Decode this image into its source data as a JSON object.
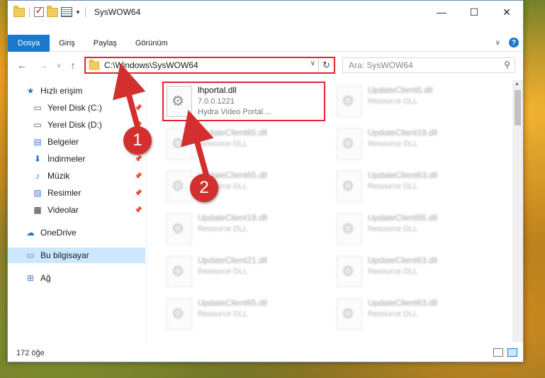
{
  "window": {
    "title": "SysWOW64",
    "controls": {
      "minimize": "—",
      "maximize": "☐",
      "close": "✕"
    }
  },
  "ribbon": {
    "tabs": [
      "Dosya",
      "Giriş",
      "Paylaş",
      "Görünüm"
    ]
  },
  "nav": {
    "address_path": "C:\\Windows\\SysWOW64",
    "search_placeholder": "Ara: SysWOW64"
  },
  "sidebar": {
    "items": [
      {
        "label": "Hızlı erişim",
        "icon": "star-icon",
        "pinned": false
      },
      {
        "label": "Yerel Disk (C:)",
        "icon": "drive-icon",
        "pinned": true
      },
      {
        "label": "Yerel Disk (D:)",
        "icon": "drive-icon",
        "pinned": true
      },
      {
        "label": "Belgeler",
        "icon": "documents-icon",
        "pinned": true
      },
      {
        "label": "İndirmeler",
        "icon": "download-icon",
        "pinned": true
      },
      {
        "label": "Müzik",
        "icon": "music-icon",
        "pinned": true
      },
      {
        "label": "Resimler",
        "icon": "pictures-icon",
        "pinned": true
      },
      {
        "label": "Videolar",
        "icon": "videos-icon",
        "pinned": true
      },
      {
        "label": "OneDrive",
        "icon": "cloud-icon",
        "pinned": false
      },
      {
        "label": "Bu bilgisayar",
        "icon": "computer-icon",
        "pinned": false
      },
      {
        "label": "Ağ",
        "icon": "network-icon",
        "pinned": false
      }
    ]
  },
  "files": {
    "highlighted": {
      "name": "lhportal.dll",
      "version": "7.0.0.1221",
      "description": "Hydra Video Portal ..."
    },
    "left_column": [
      {
        "name": "UpdateClient65.dll",
        "type": "Resource DLL"
      },
      {
        "name": "UpdateClient65.dll",
        "type": "Resource DLL"
      },
      {
        "name": "UpdateClient19.dll",
        "type": "Resource DLL"
      },
      {
        "name": "UpdateClient21.dll",
        "type": "Resource DLL"
      },
      {
        "name": "UpdateClient65.dll",
        "type": "Resource DLL"
      }
    ],
    "right_column": [
      {
        "name": "UpdateClient5.dll",
        "type": "Resource DLL"
      },
      {
        "name": "UpdateClient19.dll",
        "type": "Resource DLL"
      },
      {
        "name": "UpdateClient63.dll",
        "type": "Resource DLL"
      },
      {
        "name": "UpdateClient65.dll",
        "type": "Resource DLL"
      },
      {
        "name": "UpdateClient63.dll",
        "type": "Resource DLL"
      },
      {
        "name": "UpdateClient63.dll",
        "type": "Resource DLL"
      }
    ]
  },
  "status": {
    "count": "172 öğe"
  },
  "annotations": {
    "badge1": "1",
    "badge2": "2",
    "color": "#d32f2f"
  }
}
